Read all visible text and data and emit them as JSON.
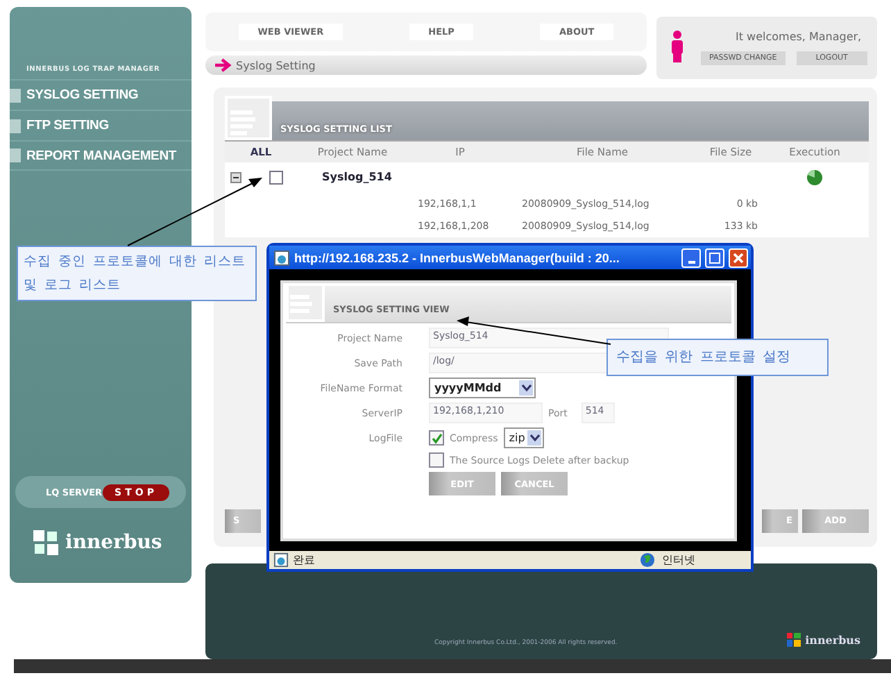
{
  "sidebar": {
    "subtitle": "INNERBUS LOG TRAP MANAGER",
    "menu": [
      {
        "label": "SYSLOG SETTING"
      },
      {
        "label": "FTP SETTING"
      },
      {
        "label": "REPORT MANAGEMENT"
      }
    ],
    "server_label": "LQ SERVER",
    "server_button": "STOP",
    "logo": "innerbus"
  },
  "nav": {
    "tabs": [
      "WEB VIEWER",
      "HELP",
      "ABOUT"
    ],
    "breadcrumb": "Syslog Setting"
  },
  "user": {
    "greeting": "It welcomes, Manager,",
    "buttons": [
      "PASSWD CHANGE",
      "LOGOUT"
    ]
  },
  "list": {
    "title": "SYSLOG SETTING LIST",
    "columns": [
      "ALL",
      "Project Name",
      "IP",
      "File Name",
      "File Size",
      "Execution"
    ],
    "projects": [
      {
        "name": "Syslog_514",
        "checked": false,
        "expanded": true,
        "running": true,
        "logs": [
          {
            "ip": "192,168,1,1",
            "file": "20080909_Syslog_514,log",
            "size": "0 kb"
          },
          {
            "ip": "192,168,1,208",
            "file": "20080909_Syslog_514,log",
            "size": "133 kb"
          }
        ]
      }
    ],
    "left_button": "S",
    "right_buttons": [
      "E",
      "ADD"
    ]
  },
  "footer": {
    "copyright": "Copyright Innerbus Co.Ltd., 2001-2006 All rights reserved.",
    "logo": "innerbus"
  },
  "popup": {
    "title": "http://192.168.235.2 - InnerbusWebManager(build : 20...",
    "heading": "SYSLOG SETTING VIEW",
    "project_name": {
      "label": "Project Name",
      "value": "Syslog_514"
    },
    "save_path": {
      "label": "Save Path",
      "value": "/log/"
    },
    "filename_format": {
      "label": "FileName Format",
      "value": "yyyyMMdd"
    },
    "server_ip": {
      "label": "ServerIP",
      "value": "192,168,1,210",
      "port_label": "Port",
      "port": "514"
    },
    "log_file": {
      "label": "LogFile",
      "compress_label": "Compress",
      "compress": true,
      "compress_type": "zip",
      "delete_label": "The Source Logs Delete after backup",
      "delete": false
    },
    "buttons": [
      "EDIT",
      "CANCEL"
    ],
    "status": "완료",
    "zone": "인터넷"
  },
  "callouts": [
    {
      "text": "수집 중인 프로토콜에 대한 리스트 및 로그 리스트"
    },
    {
      "text": "수집을 위한 프로토콜 설정"
    }
  ]
}
